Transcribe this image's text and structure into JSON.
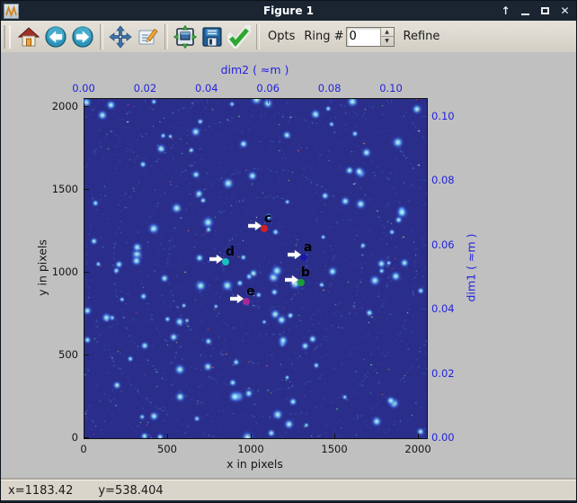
{
  "window": {
    "title": "Figure 1",
    "app_icon": "matplotlib-waveform-icon",
    "controls": {
      "rollup": "↑",
      "minimize": "minimize",
      "maximize": "maximize",
      "close": "✕"
    }
  },
  "toolbar": {
    "icons": [
      "home-icon",
      "back-icon",
      "forward-icon",
      "pan-icon",
      "edit-icon",
      "zoom-fit-icon",
      "save-icon",
      "apply-check-icon"
    ],
    "opts_label": "Opts",
    "ring_label": "Ring #",
    "ring_value": "0",
    "refine_label": "Refine"
  },
  "statusbar": {
    "x_readout": "x=1183.42",
    "y_readout": "y=538.404"
  },
  "chart_data": {
    "type": "scatter",
    "description": "Powder diffraction calibration image with picked control points",
    "xlabel": "x in pixels",
    "ylabel": "y in pixels",
    "top_axis": {
      "label": "dim2 ( ≈m )",
      "ticks": [
        0.0,
        0.02,
        0.04,
        0.06,
        0.08,
        0.1
      ],
      "max": 0.1114
    },
    "right_axis": {
      "label": "dim1 ( ≈m )",
      "ticks": [
        0.0,
        0.02,
        0.04,
        0.06,
        0.08,
        0.1
      ],
      "max": 0.1056
    },
    "xlim": [
      0,
      2048
    ],
    "ylim": [
      0,
      2048
    ],
    "x_ticks": [
      0,
      500,
      1000,
      1500,
      2000
    ],
    "y_ticks": [
      0,
      500,
      1000,
      1500,
      2000
    ],
    "axis_label_color": "#2222dd",
    "points": [
      {
        "label": "a",
        "x": 1311,
        "y": 1092,
        "color": "#1a1aa8"
      },
      {
        "label": "b",
        "x": 1295,
        "y": 940,
        "color": "#18a038"
      },
      {
        "label": "c",
        "x": 1075,
        "y": 1266,
        "color": "#d42020"
      },
      {
        "label": "d",
        "x": 844,
        "y": 1065,
        "color": "#18c0c0"
      },
      {
        "label": "e",
        "x": 968,
        "y": 826,
        "color": "#a82898"
      }
    ],
    "pattern": {
      "background": "#2a2e8a",
      "seed": 1337,
      "center": [
        200,
        185
      ],
      "ring_radii": [
        47,
        77,
        108,
        138,
        168,
        198,
        228,
        258
      ],
      "grain_count": 1200,
      "faint_count": 480,
      "blob_count": 130,
      "hot_count": 85,
      "hot_colors": [
        "#ff5030",
        "#ff9830",
        "#ffe04a",
        "#ff50b0",
        "#60ff90",
        "#ffffff"
      ]
    }
  }
}
